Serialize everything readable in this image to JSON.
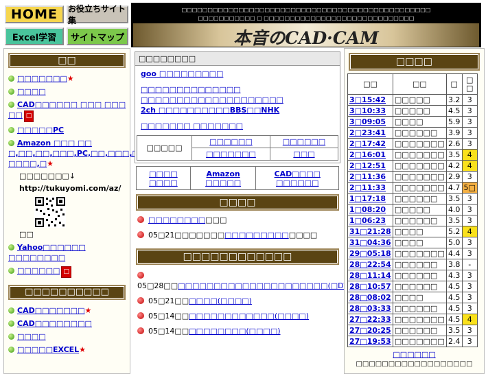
{
  "header": {
    "home_label": "HOME",
    "tools_label": "お役立ちサイト集",
    "excel_label": "Excel学習",
    "map_label": "サイトマップ",
    "tagline1": "□□□□□□□□□□□□□□□□□□□□□□□□□□□□□□□□□□□□□□□□□□□□□□□□",
    "tagline2": "□□□□□□□□□□□ □ □□□□□□□□□□□□□□□□□□□□□□□□□□□□□",
    "logo_text": "本音のCAD·CAM"
  },
  "left": {
    "menu_title": "□□",
    "items": [
      {
        "label": "□□□□□□□",
        "star": "★"
      },
      {
        "label": "□□□□"
      },
      {
        "label": "CAD□□□□□□ □□□ □□□ □□",
        "badge": "□"
      },
      {
        "label": "□□□□□PC"
      },
      {
        "label": "Amazon □□□ □□\n□,□□,□□,□□□,PC,□□,□□□,□□,\n□□□□,□",
        "star": "★"
      }
    ],
    "note1": "□□□□□□□↓",
    "note_url": "http://tukuyomi.com/az/",
    "note2": "□□",
    "items2": [
      {
        "label": "Yahoo□□□□□□\n□□□□□□□□"
      },
      {
        "label": "□□□□□□",
        "badge": "□"
      }
    ],
    "menu2_title": "□□□□□□□□□□",
    "items3": [
      {
        "label": "CAD□□□□□□□",
        "star": "★"
      },
      {
        "label": "CAD□□□□□□□□"
      },
      {
        "label": "□□□□"
      },
      {
        "label": "□□□□□EXCEL",
        "star": "★"
      }
    ]
  },
  "mid": {
    "box1_title": "□□□□□□□□",
    "box1_links": [
      "goo □□□□□□□□□",
      "□□□□□□□□□□□□□□",
      "□□□□□□□□□□□□□□□□□□□□",
      "2ch □□□□□□□□□□BBS□□NHK",
      "□□□□□□□ □□□□□□□"
    ],
    "box1_table_label": "□□□□□",
    "box1_table_links": [
      "□□□□□□",
      "□□□□□□",
      "□□□□□□□",
      "□□□"
    ],
    "box2_links": [
      {
        "l1": "□□□□",
        "l2": "□□□□"
      },
      {
        "l1": "Amazon",
        "l2": "□□□□□"
      },
      {
        "l1": "CAD□□□□",
        "l2": "□□□□□□"
      }
    ],
    "news_title": "□□□□",
    "news": [
      {
        "link": "□□□□□□□□",
        "text": "□□□"
      },
      {
        "date": "05□21□□□□□□□",
        "link": "□□□□□□□□□",
        "text": "□□□□"
      }
    ],
    "updates_title": "□□□□□□□□□□□□",
    "updates": [
      {
        "date": "05□28□□",
        "link": "□□□□□□□□□□□□□□□□□□□□□",
        "extra": "(□DVD□□)"
      },
      {
        "date": "05□21□□",
        "link": "□□□□",
        "extra": "(□□□□)"
      },
      {
        "date": "05□14□□",
        "link": "□□□□□□□□□□□□",
        "extra": "(□□□□)"
      },
      {
        "date": "05□14□□",
        "link": "□□□□□□□□",
        "extra": "(□□□□)"
      }
    ]
  },
  "right": {
    "title": "□□□□",
    "columns": [
      "□□",
      "□□",
      "□",
      "□\n□"
    ],
    "rows": [
      {
        "time": "3□15:42",
        "name": "□□□□□",
        "score": "3.2",
        "count": "3",
        "hl": ""
      },
      {
        "time": "3□10:33",
        "name": "□□□□□",
        "score": "4.5",
        "count": "3",
        "hl": ""
      },
      {
        "time": "3□09:05",
        "name": "□□□□",
        "score": "5.9",
        "count": "3",
        "hl": ""
      },
      {
        "time": "2□23:41",
        "name": "□□□□□□",
        "score": "3.9",
        "count": "3",
        "hl": ""
      },
      {
        "time": "2□17:42",
        "name": "□□□□□□□",
        "score": "2.6",
        "count": "3",
        "hl": ""
      },
      {
        "time": "2□16:01",
        "name": "□□□□□□□",
        "score": "3.5",
        "count": "4",
        "hl": "y"
      },
      {
        "time": "2□12:51",
        "name": "□□□□□□□",
        "score": "4.2",
        "count": "4",
        "hl": "y"
      },
      {
        "time": "2□11:36",
        "name": "□□□□□□□",
        "score": "2.9",
        "count": "3",
        "hl": ""
      },
      {
        "time": "2□11:33",
        "name": "□□□□□□□",
        "score": "4.7",
        "count": "5□",
        "hl": "o"
      },
      {
        "time": "1□17:18",
        "name": "□□□□□□",
        "score": "3.5",
        "count": "3",
        "hl": ""
      },
      {
        "time": "1□08:20",
        "name": "□□□□□",
        "score": "4.0",
        "count": "3",
        "hl": ""
      },
      {
        "time": "1□06:23",
        "name": "□□□□□□",
        "score": "3.5",
        "count": "3",
        "hl": ""
      },
      {
        "time": "31□21:28",
        "name": "□□□□",
        "score": "5.2",
        "count": "4",
        "hl": "y"
      },
      {
        "time": "31□04:36",
        "name": "□□□□",
        "score": "5.0",
        "count": "3",
        "hl": ""
      },
      {
        "time": "29□05:18",
        "name": "□□□□□□□",
        "score": "4.4",
        "count": "3",
        "hl": ""
      },
      {
        "time": "28□22:54",
        "name": "□□□□□□",
        "score": "3.8",
        "count": "-",
        "hl": ""
      },
      {
        "time": "28□11:14",
        "name": "□□□□□□",
        "score": "4.3",
        "count": "3",
        "hl": ""
      },
      {
        "time": "28□10:57",
        "name": "□□□□□□",
        "score": "4.5",
        "count": "3",
        "hl": ""
      },
      {
        "time": "28□08:02",
        "name": "□□□□",
        "score": "4.5",
        "count": "3",
        "hl": ""
      },
      {
        "time": "28□03:33",
        "name": "□□□□□□",
        "score": "4.5",
        "count": "3",
        "hl": ""
      },
      {
        "time": "27□22:33",
        "name": "□□□□□□□",
        "score": "4.5",
        "count": "4",
        "hl": "y"
      },
      {
        "time": "27□20:25",
        "name": "□□□□□□",
        "score": "3.5",
        "count": "3",
        "hl": ""
      },
      {
        "time": "27□19:53",
        "name": "□□□□□□□",
        "score": "2.4",
        "count": "3",
        "hl": ""
      }
    ],
    "more_link": "□□□□□□",
    "footer": "□□□□□□□□□□□□□□□□□□"
  }
}
